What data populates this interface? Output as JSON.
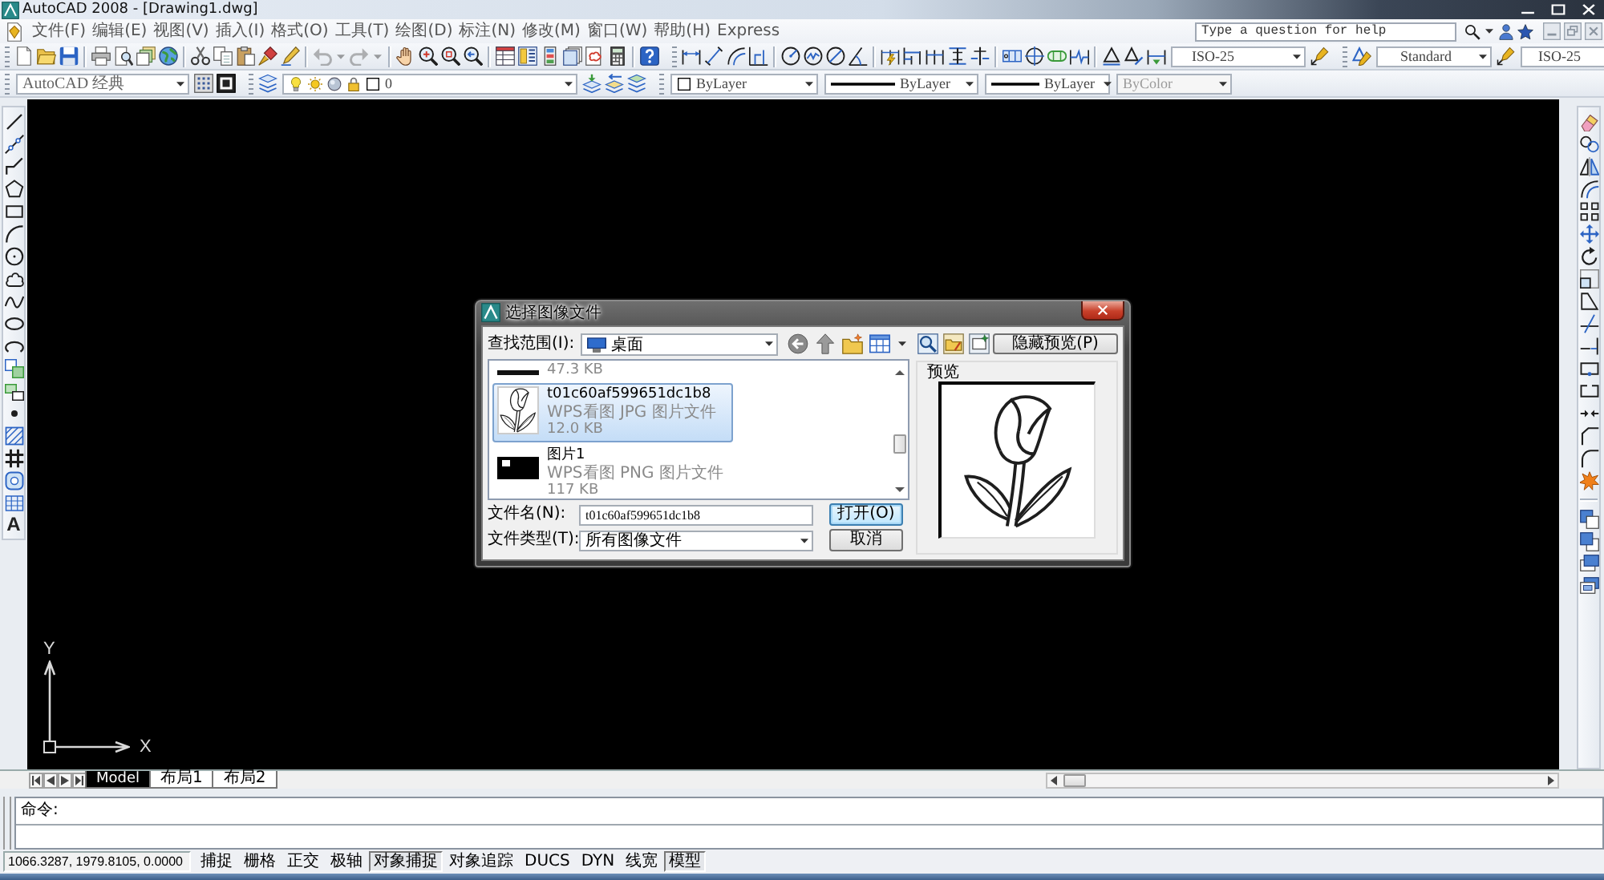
{
  "window": {
    "title": "AutoCAD 2008 - [Drawing1.dwg]"
  },
  "menu_bar": {
    "items": [
      "文件(F)",
      "编辑(E)",
      "视图(V)",
      "插入(I)",
      "格式(O)",
      "工具(T)",
      "绘图(D)",
      "标注(N)",
      "修改(M)",
      "窗口(W)",
      "帮助(H)",
      "Express"
    ],
    "help_search": {
      "placeholder": "Type a question for help"
    }
  },
  "standard_toolbar": {
    "history_buttons": [
      {
        "kind": "undo",
        "disabled": true
      },
      {
        "kind": "redo",
        "disabled": true
      }
    ]
  },
  "dimension_toolbar": {
    "style": "ISO-25"
  },
  "styles_toolbar": {
    "text_style": "Standard",
    "dimension_style": "ISO-25"
  },
  "workspaces_toolbar": {
    "workspace": "AutoCAD 经典"
  },
  "layers_toolbar": {
    "layer": "0"
  },
  "properties_toolbar": {
    "dropdowns": [
      {
        "kind": "color",
        "value": "ByLayer",
        "disabled": false
      },
      {
        "kind": "linetype",
        "value": "ByLayer",
        "disabled": false
      },
      {
        "kind": "lineweight",
        "value": "ByLayer",
        "disabled": false
      },
      {
        "kind": "plot_style",
        "value": "ByColor",
        "disabled": true
      }
    ]
  },
  "draw_toolbar": {
    "text_tool_glyph": "A"
  },
  "drawing_area": {
    "ucs_icon": {
      "y_label": "Y",
      "x_label": "X"
    }
  },
  "dialog": {
    "title": "选择图像文件",
    "look_in": {
      "label": "查找范围(I):",
      "value": "桌面"
    },
    "preview_button": "隐藏预览(P)",
    "preview_label": "预览",
    "files": [
      {
        "kind": "partial",
        "thumbnail": {
          "kind": "dark"
        },
        "size": "47.3 KB",
        "selected": false
      },
      {
        "kind": "full",
        "thumbnail": {
          "kind": "sketch"
        },
        "name": "t01c60af599651dc1b8",
        "type": "WPS看图 JPG 图片文件",
        "size": "12.0 KB",
        "selected": true
      },
      {
        "kind": "full",
        "thumbnail": {
          "kind": "dark"
        },
        "name": "图片1",
        "type": "WPS看图 PNG 图片文件",
        "size": "117 KB",
        "selected": false
      }
    ],
    "file_name": {
      "label": "文件名(N):",
      "value": "t01c60af599651dc1b8"
    },
    "file_type": {
      "label": "文件类型(T):",
      "value": "所有图像文件"
    },
    "buttons": [
      {
        "label": "打开(O)",
        "default": true
      },
      {
        "label": "取消",
        "default": false
      }
    ]
  },
  "layout_tabs": [
    {
      "label": "Model",
      "selected": true
    },
    {
      "label": "布局1",
      "selected": false
    },
    {
      "label": "布局2",
      "selected": false
    }
  ],
  "command_line": {
    "history": [
      "命令:"
    ]
  },
  "status_bar": {
    "coordinates": "1066.3287, 1979.8105, 0.0000",
    "toggles": [
      {
        "label": "捕捉",
        "on": false
      },
      {
        "label": "栅格",
        "on": false
      },
      {
        "label": "正交",
        "on": false
      },
      {
        "label": "极轴",
        "on": false
      },
      {
        "label": "对象捕捉",
        "on": true
      },
      {
        "label": "对象追踪",
        "on": false
      },
      {
        "label": "DUCS",
        "on": false
      },
      {
        "label": "DYN",
        "on": false
      },
      {
        "label": "线宽",
        "on": false
      },
      {
        "label": "模型",
        "on": true
      }
    ]
  }
}
